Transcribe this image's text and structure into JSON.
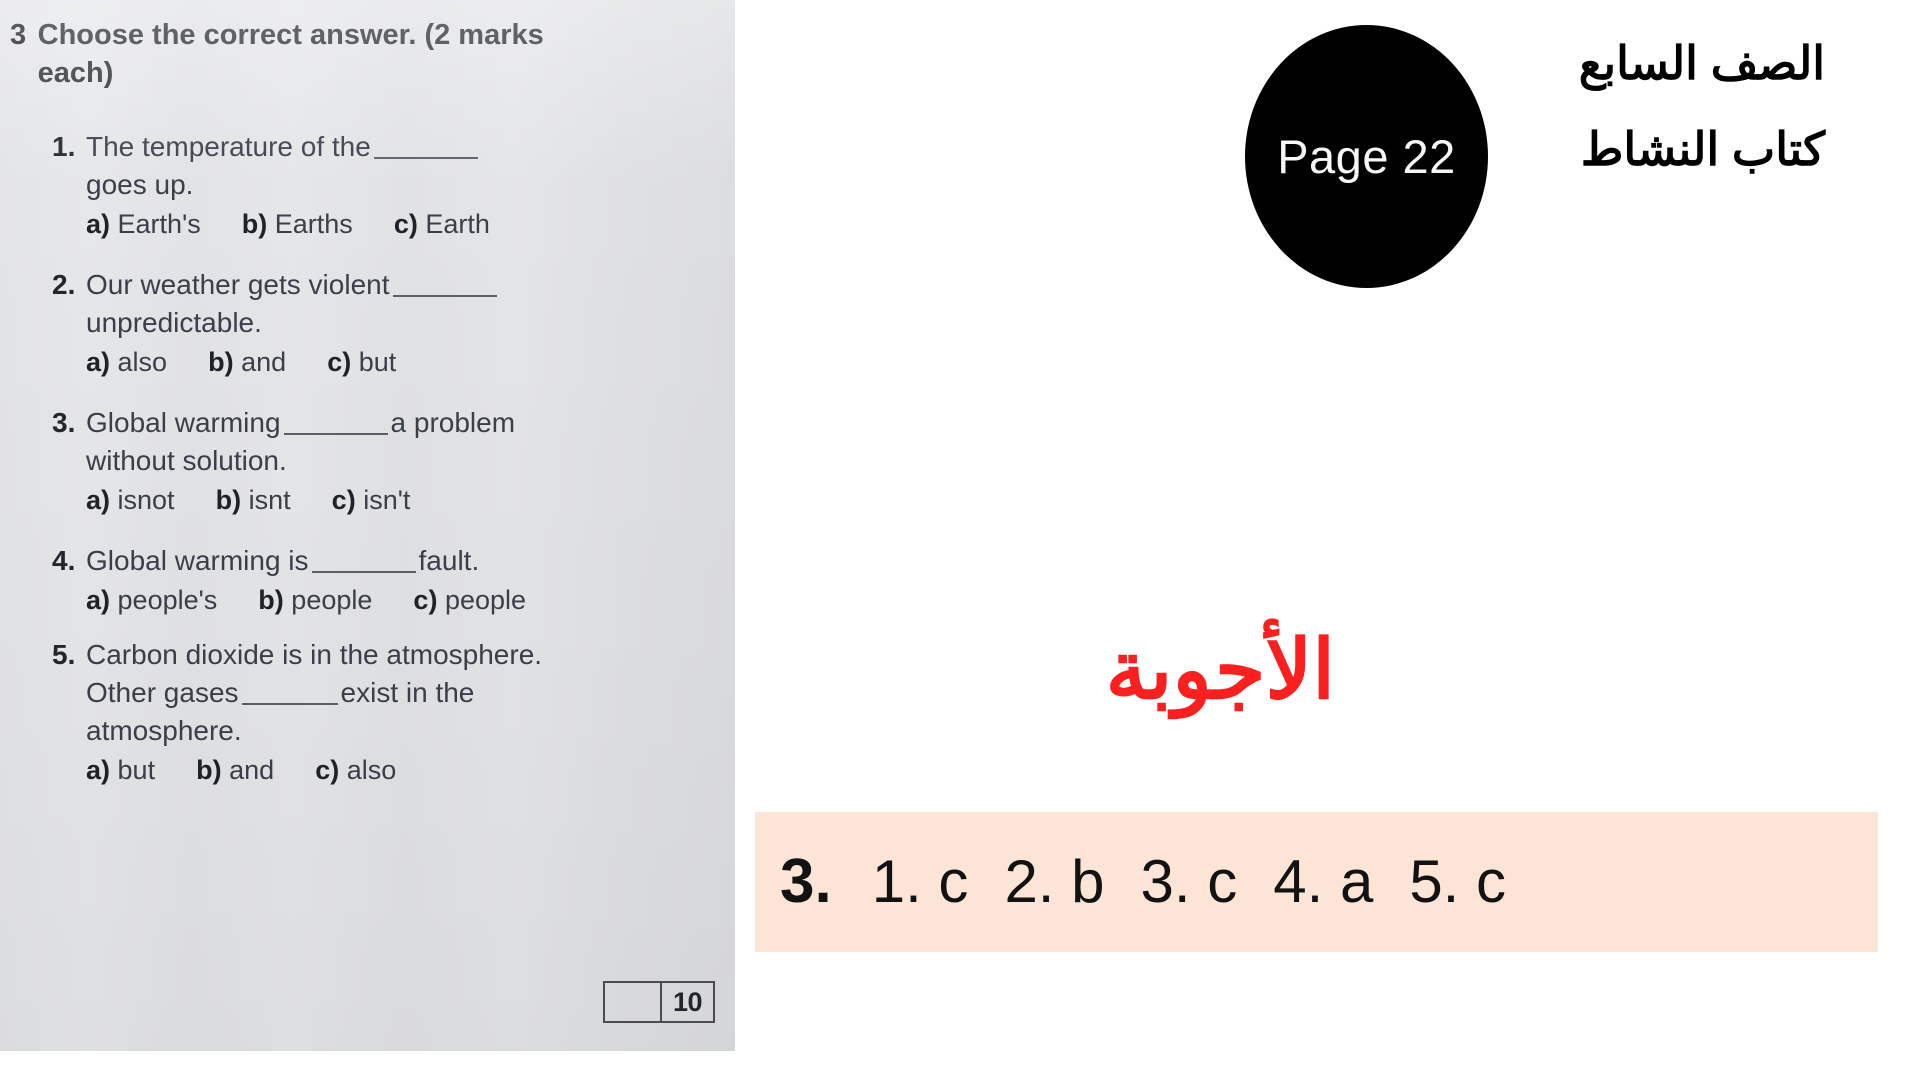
{
  "worksheet": {
    "exercise_number": "3",
    "instruction": "Choose the correct answer. (2 marks each)",
    "questions": [
      {
        "number": "1.",
        "line1_before": "The temperature of the",
        "line1_after": "",
        "line2": "goes up.",
        "options": [
          {
            "letter": "a)",
            "text": "Earth's"
          },
          {
            "letter": "b)",
            "text": "Earths"
          },
          {
            "letter": "c)",
            "text": "Earth"
          }
        ]
      },
      {
        "number": "2.",
        "line1_before": "Our weather gets violent",
        "line1_after": "",
        "line2": "unpredictable.",
        "options": [
          {
            "letter": "a)",
            "text": "also"
          },
          {
            "letter": "b)",
            "text": "and"
          },
          {
            "letter": "c)",
            "text": "but"
          }
        ]
      },
      {
        "number": "3.",
        "line1_before": "Global warming",
        "line1_after": "a problem",
        "line2": "without solution.",
        "options": [
          {
            "letter": "a)",
            "text": "isnot"
          },
          {
            "letter": "b)",
            "text": "isnt"
          },
          {
            "letter": "c)",
            "text": "isn't"
          }
        ]
      },
      {
        "number": "4.",
        "line1_before": "Global warming is",
        "line1_after": "fault.",
        "line2": "",
        "options": [
          {
            "letter": "a)",
            "text": "people's"
          },
          {
            "letter": "b)",
            "text": "people"
          },
          {
            "letter": "c)",
            "text": "people"
          }
        ]
      },
      {
        "number": "5.",
        "line1_before": "Carbon dioxide is in the atmosphere.",
        "line1_after": "",
        "line2_before": "Other gases",
        "line2_after": "exist in the",
        "line3": "atmosphere.",
        "options": [
          {
            "letter": "a)",
            "text": "but"
          },
          {
            "letter": "b)",
            "text": "and"
          },
          {
            "letter": "c)",
            "text": "also"
          }
        ]
      }
    ],
    "score_box": {
      "student_score": "",
      "total_marks": "10"
    }
  },
  "slide": {
    "page_badge": "Page 22",
    "book_header": {
      "grade": "الصف السابع",
      "book": "كتاب النشاط"
    },
    "answers_title": "الأجوبة",
    "answer_bar": {
      "exercise_label": "3.",
      "answers": [
        "1. c",
        "2. b",
        "3. c",
        "4. a",
        "5. c"
      ]
    }
  },
  "colors": {
    "badge_background": "#000000",
    "badge_text": "#f7f7f7",
    "answers_title": "#fa2020",
    "answer_bar_background": "#fce5d6",
    "worksheet_background": "#e3e4e6"
  }
}
